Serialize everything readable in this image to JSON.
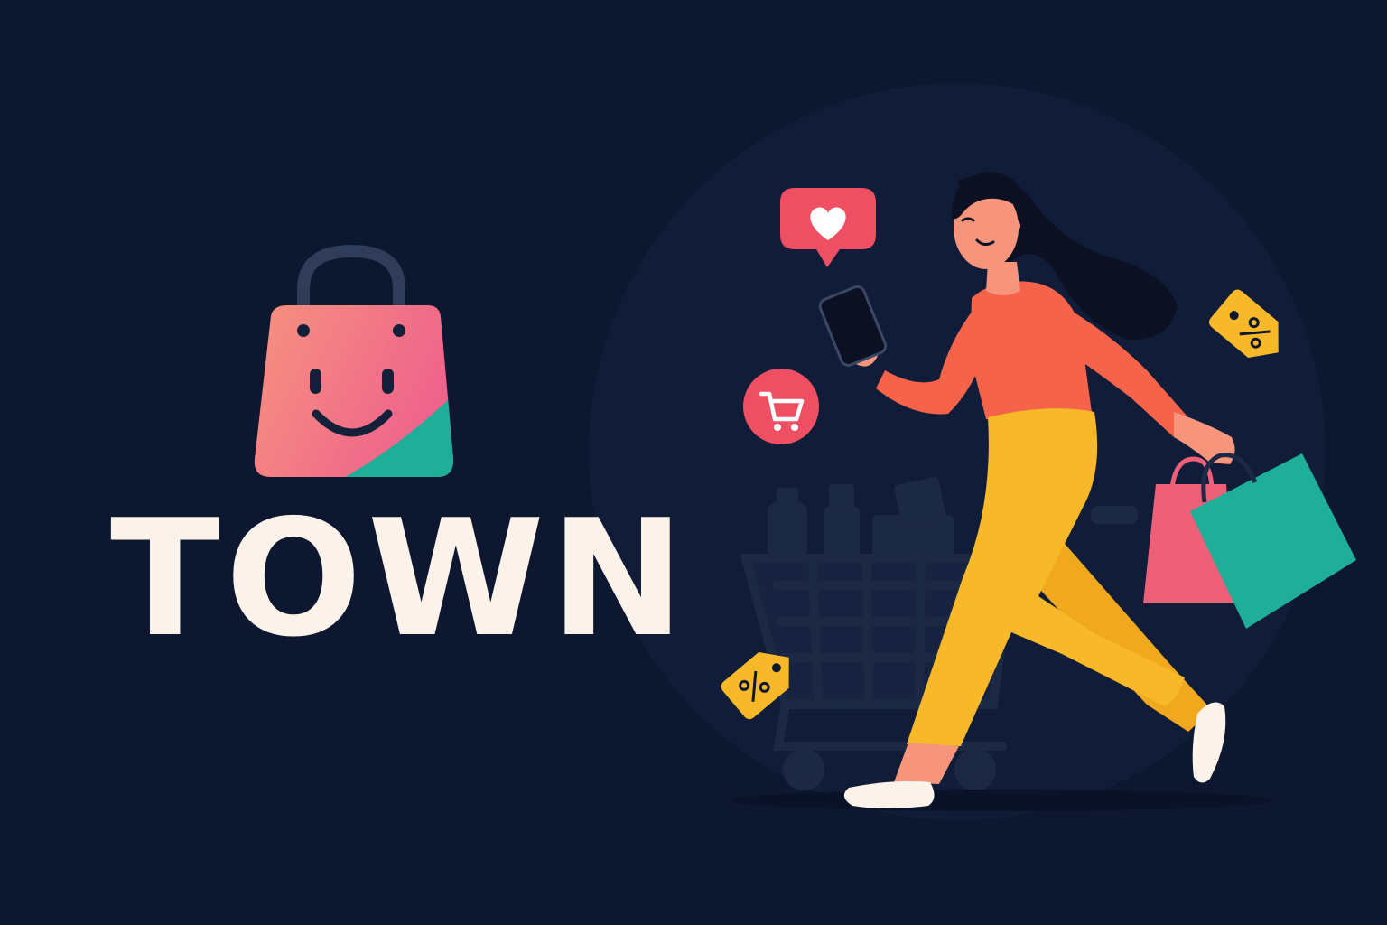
{
  "brand": {
    "name": "TOWN",
    "logo_icon": "smiling-shopping-bag-icon"
  },
  "decorations": {
    "like_bubble": "heart-speech-bubble-icon",
    "cart_badge": "shopping-cart-icon",
    "discount_tags": [
      "percent-tag-icon",
      "percent-tag-icon"
    ],
    "shopper": "woman-walking-with-phone-and-bags"
  },
  "colors": {
    "background": "#0d1730",
    "text": "#fbf3ea",
    "bag_pink": "#f26b86",
    "bag_teal": "#1fae97",
    "accent_red": "#ef4f63",
    "accent_yellow": "#f7b829",
    "top_orange": "#f4634a"
  }
}
